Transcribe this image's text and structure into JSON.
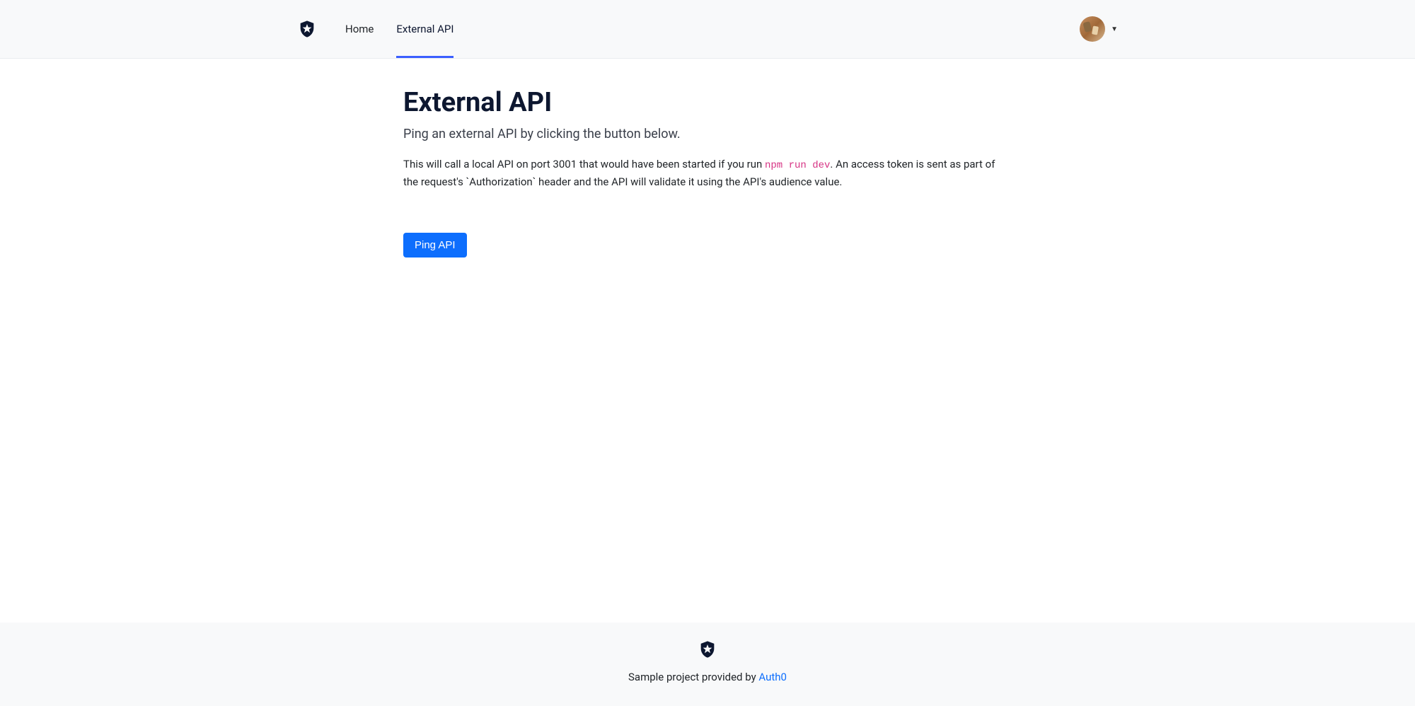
{
  "nav": {
    "home": "Home",
    "external_api": "External API"
  },
  "page": {
    "title": "External API",
    "lead": "Ping an external API by clicking the button below.",
    "desc_part1": "This will call a local API on port 3001 that would have been started if you run ",
    "desc_code": "npm run dev",
    "desc_part2": ". An access token is sent as part of the request's `Authorization` header and the API will validate it using the API's audience value.",
    "ping_button": "Ping API"
  },
  "footer": {
    "text": "Sample project provided by ",
    "link_text": "Auth0"
  }
}
